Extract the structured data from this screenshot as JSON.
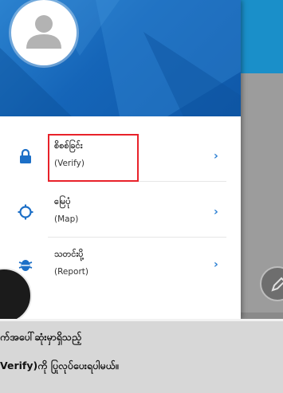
{
  "drawer": {
    "menu": [
      {
        "label_my": "စိစစ်ခြင်း",
        "label_en": "(Verify)",
        "icon": "lock-icon"
      },
      {
        "label_my": "မြေပုံ",
        "label_en": "(Map)",
        "icon": "location-icon"
      },
      {
        "label_my": "သတင်းပို့",
        "label_en": "(Report)",
        "icon": "bug-icon"
      }
    ],
    "chevron": "›"
  },
  "caption": {
    "line1": "က်အပေါ်ဆုံးမှာရှိသည့်",
    "line2": "Verify)ကို ပြုလုပ်ပေးရပါမယ်။"
  },
  "colors": {
    "header_blue": "#1565b8",
    "accent_blue": "#2b7fd3",
    "highlight_red": "#e8222a"
  }
}
